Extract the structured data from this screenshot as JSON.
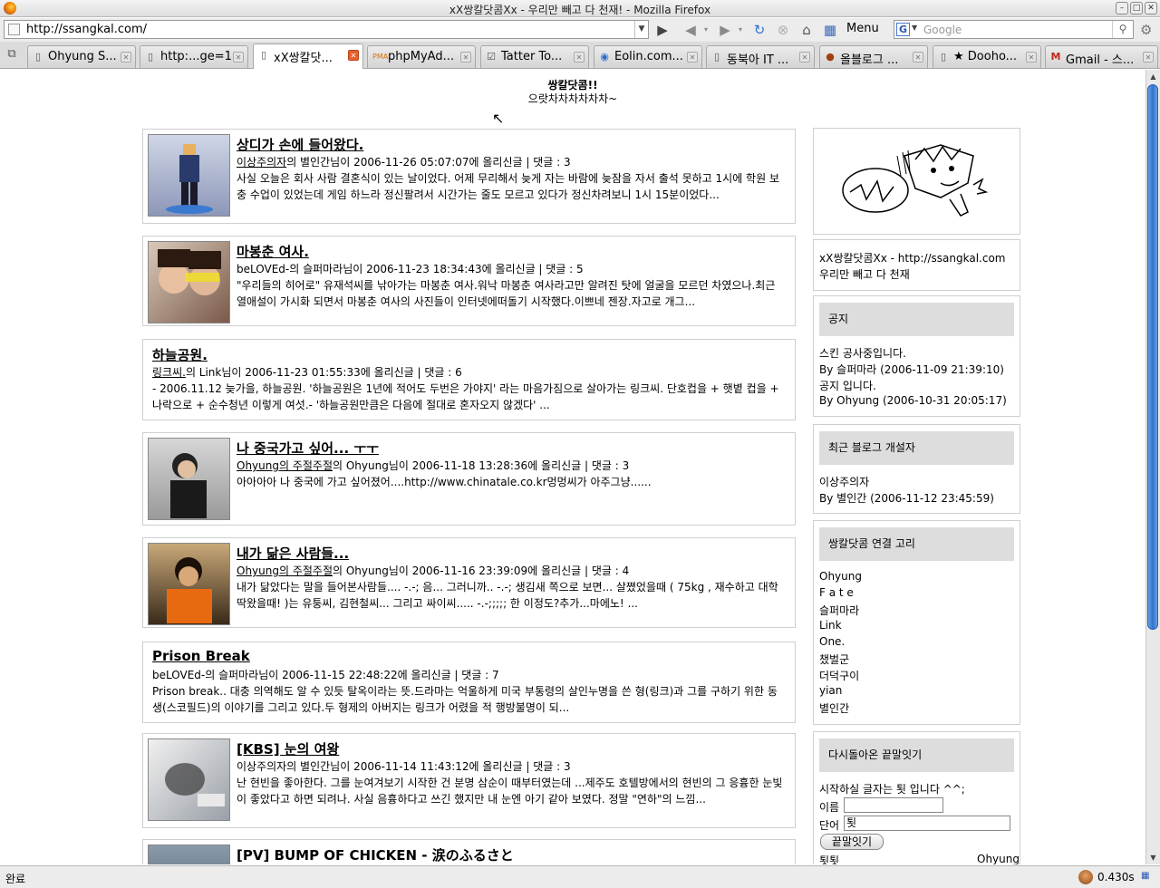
{
  "window": {
    "title": "xX쌍칼닷콤Xx - 우리만 빼고 다 천재! - Mozilla Firefox"
  },
  "nav": {
    "url": "http://ssangkal.com/",
    "menu_label": "Menu",
    "search_placeholder": "Google"
  },
  "tabs": [
    {
      "label": "Ohyung S...",
      "icon": "page-icon",
      "active": false
    },
    {
      "label": "http:...ge=1",
      "icon": "page-icon",
      "active": false
    },
    {
      "label": "xX쌍칼닷...",
      "icon": "page-icon",
      "active": true
    },
    {
      "label": "phpMyAd...",
      "icon": "pma-icon",
      "active": false
    },
    {
      "label": "Tatter To...",
      "icon": "tatter-icon",
      "active": false
    },
    {
      "label": "Eolin.com...",
      "icon": "eolin-icon",
      "active": false
    },
    {
      "label": "동북아 IT ...",
      "icon": "page-icon",
      "active": false
    },
    {
      "label": "올블로그 ...",
      "icon": "allblog-icon",
      "active": false
    },
    {
      "label": "★ Dooho...",
      "icon": "page-icon",
      "active": false
    },
    {
      "label": "Gmail - 스...",
      "icon": "gmail-icon",
      "active": false
    }
  ],
  "site": {
    "title": "쌍칼닷콤!!",
    "subtitle": "으랏차차차차차차~"
  },
  "posts": [
    {
      "title": "상디가 손에 들어왔다.",
      "meta_blog": "이상주의자",
      "meta_rest": "의 별인간님이 2006-11-26 05:07:07에 올리신글 | 댓글 : 3",
      "body": "사실 오늘은 회사 사람 결혼식이 있는 날이었다. 어제 무리해서 늦게 자는 바람에 늦잠을 자서 출석 못하고 1시에 학원 보충 수업이 있었는데 게임 하느라 정신팔려서 시간가는 줄도 모르고 있다가 정신차려보니 1시 15분이었다..."
    },
    {
      "title": "마봉춘 여사.",
      "meta_blog": "beLOVEd-",
      "meta_rest": "의 슬퍼마라님이 2006-11-23 18:34:43에 올리신글 | 댓글 : 5",
      "body": "\"우리들의 히어로\" 유재석씨를 낚아가는 마봉춘 여사.워낙 마봉춘 여사라고만 알려진 탓에 얼굴을 모르던 차였으나.최근 열애설이 가시화 되면서 마봉춘 여사의 사진들이 인터넷에떠돌기 시작했다.이쁘네 젠장.자고로 개그..."
    },
    {
      "title": "하늘공원.",
      "meta_blog": "링크씨.",
      "meta_rest": "의 Link님이 2006-11-23 01:55:33에 올리신글 | 댓글 : 6",
      "body": "- 2006.11.12 늦가을, 하늘공원.  '하늘공원은 1년에 적어도 두번은 가야지' 라는 마음가짐으로 살아가는 링크씨.  단호컵을 + 햇볕 컵을 + 나락으로 + 순수청년 이렇게 여섯.- '하늘공원만큼은 다음에 절대로 혼자오지 않겠다' ..."
    },
    {
      "title": "나 중국가고 싶어... ㅜㅜ",
      "meta_blog": "Ohyung의 주절주절",
      "meta_rest": "의 Ohyung님이 2006-11-18 13:28:36에 올리신글 | 댓글 : 3",
      "body": "아아아아 나 중국에 가고 싶어졌어....http://www.chinatale.co.kr멍멍씨가 아주그냥......"
    },
    {
      "title": "내가 닮은 사람들...",
      "meta_blog": "Ohyung의 주절주절",
      "meta_rest": "의 Ohyung님이 2006-11-16 23:39:09에 올리신글 | 댓글 : 4",
      "body": "내가 닮았다는 말을 들어본사람들.... -.-; 음... 그러니까.. -.-; 생김새 쪽으로 보면... 살쪘었을때 ( 75kg , 재수하고 대학 딱왔을때! )는 유퉁씨, 김현철씨... 그리고 싸이씨..... -.-;;;;; 한 이정도?추가...마에노! ..."
    },
    {
      "title": "Prison Break",
      "meta_blog": "beLOVEd-",
      "meta_rest": "의 슬퍼마라님이 2006-11-15 22:48:22에 올리신글 | 댓글 : 7",
      "body": "Prison break.. 대충 의역해도 알 수 있듯 탈옥이라는 뜻.드라마는 억울하게 미국 부통령의 살인누명을 쓴 형(링크)과 그를 구하기 위한 동생(스코필드)의 이야기를 그리고 있다.두 형제의 아버지는 링크가 어렸을 적 행방불명이 되..."
    },
    {
      "title": "[KBS] 눈의 여왕",
      "meta_blog": "이상주의자",
      "meta_rest": "의 별인간님이 2006-11-14 11:43:12에 올리신글 | 댓글 : 3",
      "body": "난 현빈을 좋아한다. 그를 눈여겨보기 시작한 건 분명 삼순이 때부터였는데 ...제주도 호텔방에서의 현빈의 그 응흉한 눈빛이 좋았다고 하면 되려나. 사실 음흉하다고 쓰긴 했지만 내 눈엔 아기 같아 보였다. 정말 \"연하\"의 느낌..."
    },
    {
      "title": "[PV] BUMP OF CHICKEN - 涙のふるさと",
      "meta_blog": "",
      "meta_rest": "",
      "body": ""
    }
  ],
  "sidebar": {
    "blog_name": "xX쌍칼닷콤Xx - http://ssangkal.com",
    "blog_desc": "우리만 빼고 다 천재",
    "notice": {
      "heading": "공지",
      "items": [
        {
          "title": "스킨 공사중입니다.",
          "by": "By 슬퍼마라 (2006-11-09 21:39:10)"
        },
        {
          "title": "공지 입니다.",
          "by": "By Ohyung (2006-10-31 20:05:17)"
        }
      ]
    },
    "recent": {
      "heading": "최근 블로그 개설자",
      "name": "이상주의자",
      "by": "By 별인간 (2006-11-12 23:45:59)"
    },
    "links": {
      "heading": "쌍칼닷콤 연결 고리",
      "items": [
        "Ohyung",
        "F a t e",
        "슬퍼마라",
        "Link",
        "One.",
        "챘벌군",
        "더덕구이",
        "yian",
        "별인간"
      ]
    },
    "wordchain": {
      "heading": "다시돌아온 끝말잇기",
      "prompt": "시작하실 글자는 툇 입니다 ^^;",
      "name_label": "이름",
      "name_value": "",
      "word_label": "단어",
      "word_value": "툇",
      "button": "끝말잇기",
      "last_word": "툇툇",
      "last_user": "Ohyung"
    }
  },
  "status": {
    "text": "완료",
    "timing": "0.430s"
  }
}
